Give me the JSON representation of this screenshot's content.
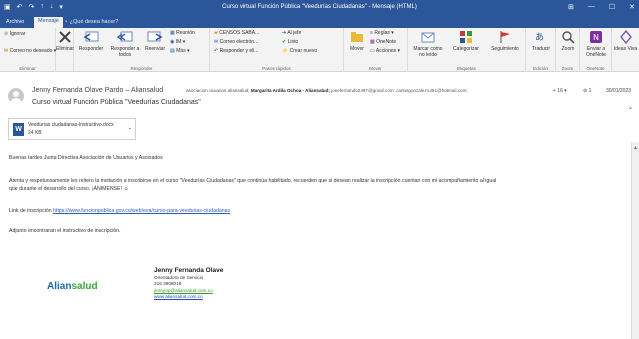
{
  "titlebar": {
    "title": "Curso virtual Función Pública \"Veedurías Ciudadanas\" - Mensaje (HTML)",
    "qat": [
      "save-icon",
      "undo-icon",
      "redo-icon",
      "up-icon",
      "down-icon",
      "customize-icon"
    ],
    "controls": [
      "⊞",
      "—",
      "☐",
      "✕"
    ]
  },
  "tabs": {
    "archivo": "Archivo",
    "mensaje": "Mensaje",
    "tellme": "♀ ¿Qué desea hacer?"
  },
  "ribbon": {
    "eliminar": {
      "ignorar": "Ignorar",
      "correo_no_deseado": "Correo no deseado ▾",
      "eliminar": "Eliminar",
      "label": "Eliminar"
    },
    "responder": {
      "responder": "Responder",
      "responder_todos": "Responder a todos",
      "reenviar": "Reenviar",
      "reunion": "Reunión",
      "im": "IM ▾",
      "mas": "Más ▾",
      "label": "Responder"
    },
    "pasos": {
      "items": [
        "CENSOS SABA...",
        "Correo electrón...",
        "Responder y eli..."
      ],
      "items2": [
        "Al jefe",
        "Listo",
        "Crear nuevo"
      ],
      "label": "Pasos rápidos"
    },
    "mover": {
      "mover": "Mover",
      "reglas": "Reglas ▾",
      "onenote": "OneNote",
      "acciones": "Acciones ▾",
      "label": "Mover"
    },
    "etiquetas": {
      "marcar": "Marcar como no leído",
      "categorizar": "Categorizar",
      "seguimiento": "Seguimiento",
      "label": "Etiquetas"
    },
    "edicion": {
      "traducir": "Traducir",
      "label": "Edición"
    },
    "zoom": {
      "zoom": "Zoom",
      "label": "Zoom"
    },
    "onenote": {
      "enviar": "Enviar a OneNote",
      "label": "OneNote"
    },
    "ideas": {
      "ideas": "Ideas Viva"
    }
  },
  "message": {
    "sender": "Jenny Fernanda Olave Pardo – Aliansalud",
    "recipients_pre": "asociacion usuarios aliansalud;",
    "recipients_bold": "Margarita Ardila Ochoa - Aliansalud;",
    "recipients_post": "josefernando2467@gmail.com;  carlosgonzalez1451@hotmail.com;",
    "more": "+ 16 ▾",
    "count": "1",
    "date": "30/01/2023",
    "subject": "Curso virtual Función Pública \"Veedurías Ciudadanas\"",
    "attachment_name": "Veedurias ciudadanas-Instructivo.docx",
    "attachment_size": "24 KB"
  },
  "body": {
    "greeting": "Buenas tardes  Junta Directiva Asociación de Usuarios y Asociados",
    "p1_line1": "Atenta y respetuosamente les reitero la invitación a inscribirse en el curso \"Veedurías  Ciudadanas\"  que continúa habilitado, recuerden que si desean realizar la inscripción cuentan con mi acompañamiento al igual",
    "p1_line2": "que durante el desarrollo del curso. ¡ÁNIMENSE! ☺",
    "link_label": "Link de inscripción",
    "link": "https://www.funcionpublica.gov.co/web/eva/curso-para-veedurias-ciudadanas",
    "adjunto": "Adjunto encontraran el instructivo de inscripción."
  },
  "signature": {
    "logo_a": "Alian",
    "logo_b": "salud",
    "name": "Jenny Fernanda Olave",
    "role": "Orientadora de Servicio",
    "phone": "316 3908018",
    "email": "jennyop@aliansalud.com.co",
    "web": "www.aliansalud.com.co"
  },
  "colors": {
    "accent": "#2b579a",
    "link": "#2b5fb4",
    "brand_green": "#3aa33a"
  }
}
